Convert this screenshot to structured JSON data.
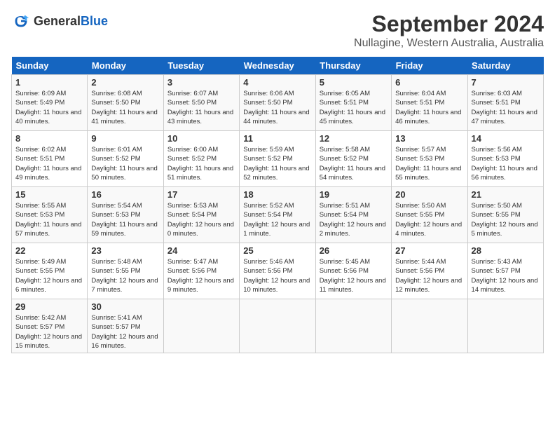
{
  "header": {
    "logo_general": "General",
    "logo_blue": "Blue",
    "month": "September 2024",
    "location": "Nullagine, Western Australia, Australia"
  },
  "columns": [
    "Sunday",
    "Monday",
    "Tuesday",
    "Wednesday",
    "Thursday",
    "Friday",
    "Saturday"
  ],
  "weeks": [
    [
      {
        "day": "1",
        "sunrise": "6:09 AM",
        "sunset": "5:49 PM",
        "daylight": "11 hours and 40 minutes."
      },
      {
        "day": "2",
        "sunrise": "6:08 AM",
        "sunset": "5:50 PM",
        "daylight": "11 hours and 41 minutes."
      },
      {
        "day": "3",
        "sunrise": "6:07 AM",
        "sunset": "5:50 PM",
        "daylight": "11 hours and 43 minutes."
      },
      {
        "day": "4",
        "sunrise": "6:06 AM",
        "sunset": "5:50 PM",
        "daylight": "11 hours and 44 minutes."
      },
      {
        "day": "5",
        "sunrise": "6:05 AM",
        "sunset": "5:51 PM",
        "daylight": "11 hours and 45 minutes."
      },
      {
        "day": "6",
        "sunrise": "6:04 AM",
        "sunset": "5:51 PM",
        "daylight": "11 hours and 46 minutes."
      },
      {
        "day": "7",
        "sunrise": "6:03 AM",
        "sunset": "5:51 PM",
        "daylight": "11 hours and 47 minutes."
      }
    ],
    [
      {
        "day": "8",
        "sunrise": "6:02 AM",
        "sunset": "5:51 PM",
        "daylight": "11 hours and 49 minutes."
      },
      {
        "day": "9",
        "sunrise": "6:01 AM",
        "sunset": "5:52 PM",
        "daylight": "11 hours and 50 minutes."
      },
      {
        "day": "10",
        "sunrise": "6:00 AM",
        "sunset": "5:52 PM",
        "daylight": "11 hours and 51 minutes."
      },
      {
        "day": "11",
        "sunrise": "5:59 AM",
        "sunset": "5:52 PM",
        "daylight": "11 hours and 52 minutes."
      },
      {
        "day": "12",
        "sunrise": "5:58 AM",
        "sunset": "5:52 PM",
        "daylight": "11 hours and 54 minutes."
      },
      {
        "day": "13",
        "sunrise": "5:57 AM",
        "sunset": "5:53 PM",
        "daylight": "11 hours and 55 minutes."
      },
      {
        "day": "14",
        "sunrise": "5:56 AM",
        "sunset": "5:53 PM",
        "daylight": "11 hours and 56 minutes."
      }
    ],
    [
      {
        "day": "15",
        "sunrise": "5:55 AM",
        "sunset": "5:53 PM",
        "daylight": "11 hours and 57 minutes."
      },
      {
        "day": "16",
        "sunrise": "5:54 AM",
        "sunset": "5:53 PM",
        "daylight": "11 hours and 59 minutes."
      },
      {
        "day": "17",
        "sunrise": "5:53 AM",
        "sunset": "5:54 PM",
        "daylight": "12 hours and 0 minutes."
      },
      {
        "day": "18",
        "sunrise": "5:52 AM",
        "sunset": "5:54 PM",
        "daylight": "12 hours and 1 minute."
      },
      {
        "day": "19",
        "sunrise": "5:51 AM",
        "sunset": "5:54 PM",
        "daylight": "12 hours and 2 minutes."
      },
      {
        "day": "20",
        "sunrise": "5:50 AM",
        "sunset": "5:55 PM",
        "daylight": "12 hours and 4 minutes."
      },
      {
        "day": "21",
        "sunrise": "5:50 AM",
        "sunset": "5:55 PM",
        "daylight": "12 hours and 5 minutes."
      }
    ],
    [
      {
        "day": "22",
        "sunrise": "5:49 AM",
        "sunset": "5:55 PM",
        "daylight": "12 hours and 6 minutes."
      },
      {
        "day": "23",
        "sunrise": "5:48 AM",
        "sunset": "5:55 PM",
        "daylight": "12 hours and 7 minutes."
      },
      {
        "day": "24",
        "sunrise": "5:47 AM",
        "sunset": "5:56 PM",
        "daylight": "12 hours and 9 minutes."
      },
      {
        "day": "25",
        "sunrise": "5:46 AM",
        "sunset": "5:56 PM",
        "daylight": "12 hours and 10 minutes."
      },
      {
        "day": "26",
        "sunrise": "5:45 AM",
        "sunset": "5:56 PM",
        "daylight": "12 hours and 11 minutes."
      },
      {
        "day": "27",
        "sunrise": "5:44 AM",
        "sunset": "5:56 PM",
        "daylight": "12 hours and 12 minutes."
      },
      {
        "day": "28",
        "sunrise": "5:43 AM",
        "sunset": "5:57 PM",
        "daylight": "12 hours and 14 minutes."
      }
    ],
    [
      {
        "day": "29",
        "sunrise": "5:42 AM",
        "sunset": "5:57 PM",
        "daylight": "12 hours and 15 minutes."
      },
      {
        "day": "30",
        "sunrise": "5:41 AM",
        "sunset": "5:57 PM",
        "daylight": "12 hours and 16 minutes."
      },
      null,
      null,
      null,
      null,
      null
    ]
  ]
}
